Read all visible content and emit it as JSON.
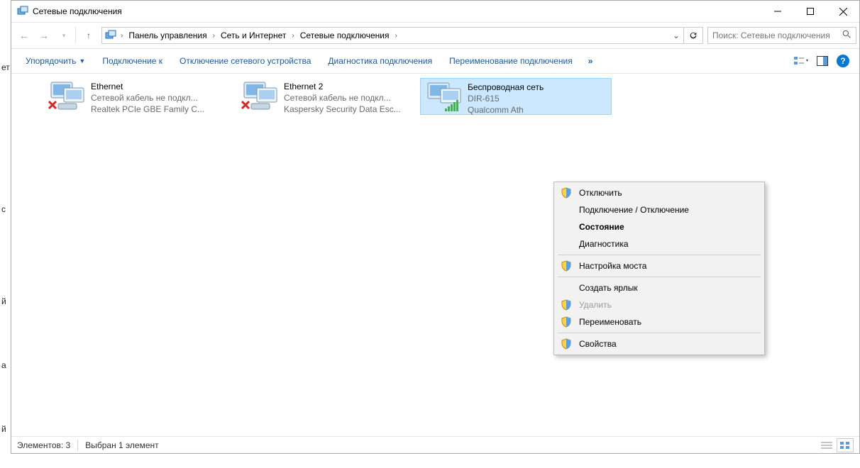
{
  "window": {
    "title": "Сетевые подключения"
  },
  "nav": {
    "crumbs": [
      "Панель управления",
      "Сеть и Интернет",
      "Сетевые подключения"
    ],
    "search_placeholder": "Поиск: Сетевые подключения"
  },
  "toolbar": {
    "items": [
      "Упорядочить",
      "Подключение к",
      "Отключение сетевого устройства",
      "Диагностика подключения",
      "Переименование подключения"
    ],
    "overflow": "»"
  },
  "connections": [
    {
      "name": "Ethernet",
      "status": "Сетевой кабель не подкл...",
      "device": "Realtek PCIe GBE Family C...",
      "disconnected": true
    },
    {
      "name": "Ethernet 2",
      "status": "Сетевой кабель не подкл...",
      "device": "Kaspersky Security Data Esc...",
      "disconnected": true
    },
    {
      "name": "Беспроводная сеть",
      "status": "DIR-615",
      "device": "Qualcomm Ath",
      "disconnected": false,
      "selected": true,
      "wifi": true
    }
  ],
  "context_menu": [
    {
      "label": "Отключить",
      "shield": true
    },
    {
      "label": "Подключение / Отключение"
    },
    {
      "label": "Состояние",
      "bold": true
    },
    {
      "label": "Диагностика"
    },
    {
      "sep": true
    },
    {
      "label": "Настройка моста",
      "shield": true
    },
    {
      "sep": true
    },
    {
      "label": "Создать ярлык"
    },
    {
      "label": "Удалить",
      "shield": true,
      "disabled": true
    },
    {
      "label": "Переименовать",
      "shield": true
    },
    {
      "sep": true
    },
    {
      "label": "Свойства",
      "shield": true
    }
  ],
  "status": {
    "count_label": "Элементов: 3",
    "selection_label": "Выбран 1 элемент"
  },
  "left_chars": [
    "ет",
    "с",
    "й",
    "а",
    "й"
  ]
}
